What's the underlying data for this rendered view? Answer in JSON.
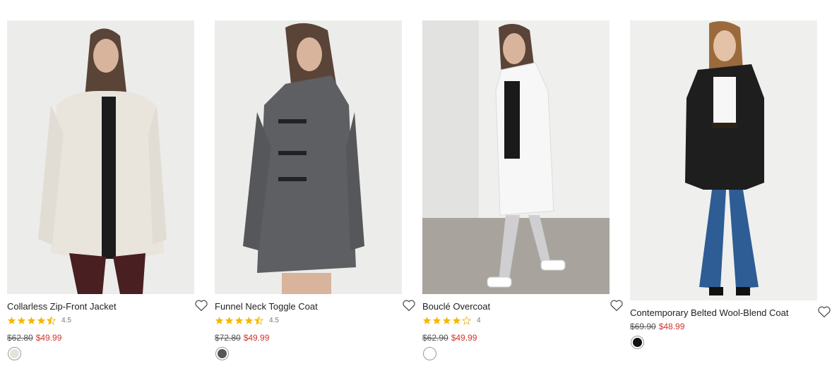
{
  "products": [
    {
      "name": "Collarless Zip-Front Jacket",
      "rating": 4.5,
      "rating_label": "4.5",
      "original_price": "$62.80",
      "sale_price": "$49.99",
      "swatch_color": "#e6e1da",
      "coat_color": "#e9e4dc"
    },
    {
      "name": "Funnel Neck Toggle Coat",
      "rating": 4.5,
      "rating_label": "4.5",
      "original_price": "$72.80",
      "sale_price": "$49.99",
      "swatch_color": "#55575a",
      "coat_color": "#5e5f62"
    },
    {
      "name": "Bouclé Overcoat",
      "rating": 4,
      "rating_label": "4",
      "original_price": "$62.90",
      "sale_price": "$49.99",
      "swatch_color": "#ffffff",
      "coat_color": "#f7f7f7"
    },
    {
      "name": "Contemporary Belted Wool-Blend Coat",
      "original_price": "$69.90",
      "sale_price": "$48.99",
      "swatch_color": "#111111",
      "coat_color": "#1e1e1e"
    }
  ],
  "colors": {
    "star": "#f5b800",
    "star_empty": "#c9c9c9",
    "sale": "#d0342c"
  },
  "icons": {
    "favorite": "heart-outline-icon",
    "rating": "star-icon"
  }
}
